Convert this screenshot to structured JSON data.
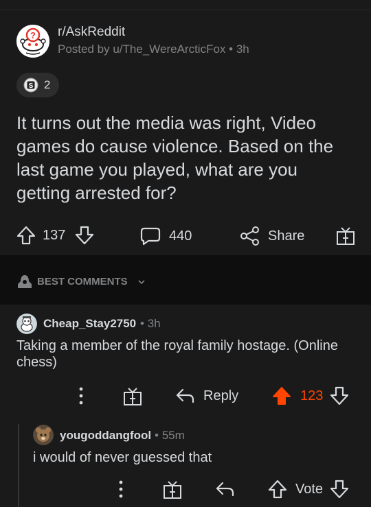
{
  "post": {
    "subreddit": "r/AskReddit",
    "meta_prefix": "Posted by",
    "author": "u/The_WereArcticFox",
    "separator": "•",
    "time": "3h",
    "award_count": "2",
    "title": "It turns out the media was right, Video games do cause violence. Based on the last game you played, what are you getting arrested for?",
    "upvotes": "137",
    "comments": "440",
    "share_label": "Share",
    "colors": {
      "background": "#1a1a1b",
      "text": "#d7dadc",
      "muted": "#818384"
    }
  },
  "sort": {
    "label": "BEST COMMENTS"
  },
  "comments": [
    {
      "user": "Cheap_Stay2750",
      "separator": "•",
      "time": "3h",
      "body_line1": "Taking a member of the royal family hostage. (Online",
      "body_line2": "chess)",
      "reply_label": "Reply",
      "score": "123",
      "upvoted": true,
      "upvote_color": "#ff4500"
    },
    {
      "user": "yougoddangfool",
      "separator": "•",
      "time": "55m",
      "body": "i would of never guessed that",
      "vote_label": "Vote"
    }
  ],
  "icons": [
    "reddit-snoo-icon",
    "award-coin-icon",
    "upvote-icon",
    "downvote-icon",
    "comment-icon",
    "share-icon",
    "gift-award-icon",
    "mod-shield-icon",
    "chevron-down-icon",
    "more-icon",
    "reply-icon"
  ]
}
